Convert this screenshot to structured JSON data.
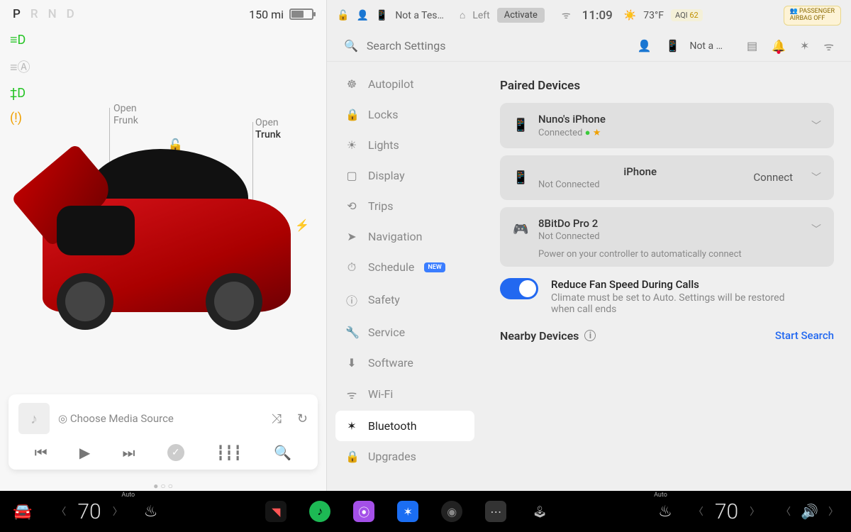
{
  "left": {
    "gears": [
      "P",
      "R",
      "N",
      "D"
    ],
    "gear_active": "P",
    "range": "150 mi",
    "frunk_line1": "Open",
    "frunk_line2": "Frunk",
    "trunk_line1": "Open",
    "trunk_line2": "Trunk",
    "media_source": "Choose Media Source"
  },
  "status": {
    "profile": "Not a Tes…",
    "homelink": "Left",
    "activate": "Activate",
    "time": "11:09",
    "temp": "73°F",
    "aqi_label": "AQI",
    "aqi_value": "62",
    "airbag_l1": "PASSENGER",
    "airbag_l2": "AIRBAG OFF"
  },
  "search": {
    "placeholder": "Search Settings",
    "profile": "Not a …"
  },
  "nav": {
    "items": [
      {
        "icon": "☸",
        "label": "Autopilot"
      },
      {
        "icon": "🔒",
        "label": "Locks"
      },
      {
        "icon": "☀",
        "label": "Lights"
      },
      {
        "icon": "▢",
        "label": "Display"
      },
      {
        "icon": "⟲",
        "label": "Trips"
      },
      {
        "icon": "➤",
        "label": "Navigation"
      },
      {
        "icon": "⏱",
        "label": "Schedule",
        "badge": "NEW"
      },
      {
        "icon": "ⓘ",
        "label": "Safety"
      },
      {
        "icon": "🔧",
        "label": "Service"
      },
      {
        "icon": "⬇",
        "label": "Software"
      },
      {
        "icon": "ᯤ",
        "label": "Wi-Fi"
      },
      {
        "icon": "✶",
        "label": "Bluetooth"
      },
      {
        "icon": "🔒",
        "label": "Upgrades"
      }
    ],
    "active_index": 11
  },
  "bluetooth": {
    "paired_title": "Paired Devices",
    "devices": [
      {
        "icon": "phone",
        "name": "Nuno's iPhone",
        "status": "Connected",
        "connected": true,
        "starred": true
      },
      {
        "icon": "phone",
        "name": "iPhone",
        "status": "Not Connected",
        "action": "Connect"
      },
      {
        "icon": "gamepad",
        "name": "8BitDo Pro 2",
        "status": "Not Connected",
        "note": "Power on your controller to automatically connect"
      }
    ],
    "reduce_title": "Reduce Fan Speed During Calls",
    "reduce_sub": "Climate must be set to Auto. Settings will be restored when call ends",
    "reduce_on": true,
    "nearby_title": "Nearby Devices",
    "nearby_action": "Start Search"
  },
  "bottom": {
    "auto": "Auto",
    "left_temp": "70",
    "right_temp": "70"
  }
}
